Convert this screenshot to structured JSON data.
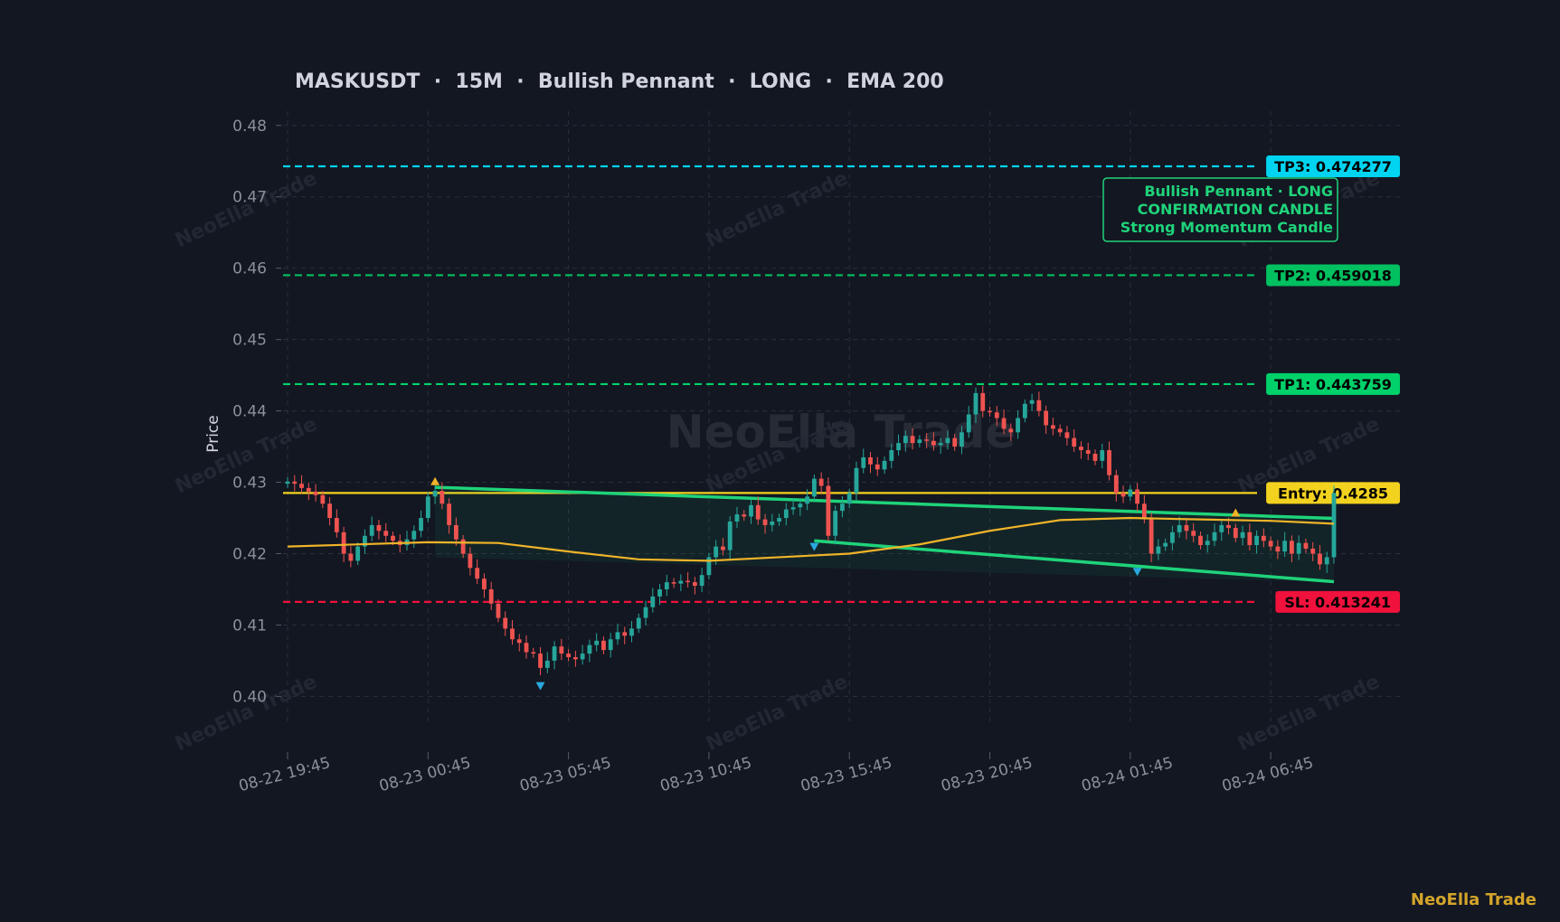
{
  "chart_data": {
    "type": "candlestick",
    "title": "MASKUSDT  ·  15M  ·  Bullish Pennant  ·  LONG  ·  EMA 200",
    "ylabel": "Price",
    "ylim": [
      0.396,
      0.482
    ],
    "yticks": [
      "0.40",
      "0.41",
      "0.42",
      "0.43",
      "0.44",
      "0.45",
      "0.46",
      "0.47",
      "0.48"
    ],
    "ytick_values": [
      0.4,
      0.41,
      0.42,
      0.43,
      0.44,
      0.45,
      0.46,
      0.47,
      0.48
    ],
    "xticks": [
      "08-22 19:45",
      "08-23 00:45",
      "08-23 05:45",
      "08-23 10:45",
      "08-23 15:45",
      "08-23 20:45",
      "08-24 01:45",
      "08-24 06:45"
    ],
    "xtick_index": [
      0,
      20,
      40,
      60,
      80,
      100,
      120,
      140
    ],
    "candle_count": 150,
    "grid": true,
    "levels": [
      {
        "label": "TP3: 0.474277",
        "value": 0.474277,
        "color": "#00d4f0",
        "dash": true
      },
      {
        "label": "TP2: 0.459018",
        "value": 0.459018,
        "color": "#00c060",
        "dash": true
      },
      {
        "label": "TP1: 0.443759",
        "value": 0.443759,
        "color": "#00d16a",
        "dash": true
      },
      {
        "label": "Entry: 0.4285",
        "value": 0.4285,
        "color": "#f3d21f",
        "dash": false
      },
      {
        "label": "SL: 0.413241",
        "value": 0.413241,
        "color": "#f0123c",
        "dash": true
      }
    ],
    "annotation": [
      "Bullish Pennant · LONG",
      "CONFIRMATION CANDLE",
      "Strong Momentum Candle"
    ],
    "watermark": "NeoElla Trade",
    "colors": {
      "up": "#26a69a",
      "down": "#ef5350",
      "ema": "#f0b429",
      "pattern": "#1fd37a",
      "bg": "#131722",
      "marker_high": "#f0b429",
      "marker_low": "#29a8e0"
    },
    "pennant": {
      "upper": {
        "x": [
          21,
          150
        ],
        "y": [
          0.4293,
          0.4249
        ]
      },
      "lower": {
        "x": [
          75,
          150
        ],
        "y": [
          0.4218,
          0.416
        ]
      }
    },
    "markers": [
      {
        "x": 21,
        "y": 0.4296,
        "type": "high"
      },
      {
        "x": 36,
        "y": 0.402,
        "type": "low"
      },
      {
        "x": 75,
        "y": 0.4215,
        "type": "low"
      },
      {
        "x": 121,
        "y": 0.418,
        "type": "low"
      },
      {
        "x": 135,
        "y": 0.4252,
        "type": "high"
      }
    ],
    "closes": [
      0.4301,
      0.4298,
      0.4292,
      0.4287,
      0.4282,
      0.427,
      0.425,
      0.423,
      0.42,
      0.419,
      0.421,
      0.4225,
      0.424,
      0.4232,
      0.4225,
      0.4218,
      0.4212,
      0.422,
      0.4232,
      0.425,
      0.428,
      0.4288,
      0.427,
      0.424,
      0.422,
      0.42,
      0.418,
      0.4165,
      0.415,
      0.413,
      0.411,
      0.4095,
      0.408,
      0.4075,
      0.4062,
      0.406,
      0.404,
      0.405,
      0.407,
      0.406,
      0.4055,
      0.4052,
      0.406,
      0.4072,
      0.4078,
      0.4065,
      0.408,
      0.409,
      0.4085,
      0.4095,
      0.411,
      0.4125,
      0.414,
      0.415,
      0.416,
      0.4158,
      0.4162,
      0.416,
      0.4155,
      0.417,
      0.4195,
      0.421,
      0.4205,
      0.4245,
      0.4255,
      0.4252,
      0.4268,
      0.4248,
      0.424,
      0.4245,
      0.425,
      0.4262,
      0.4265,
      0.427,
      0.428,
      0.4305,
      0.4295,
      0.4225,
      0.426,
      0.427,
      0.4285,
      0.432,
      0.4335,
      0.4325,
      0.4318,
      0.433,
      0.4345,
      0.4355,
      0.4365,
      0.4355,
      0.436,
      0.4358,
      0.4352,
      0.4355,
      0.4362,
      0.435,
      0.437,
      0.4395,
      0.4425,
      0.44,
      0.4398,
      0.439,
      0.4375,
      0.437,
      0.439,
      0.441,
      0.4415,
      0.44,
      0.438,
      0.4375,
      0.437,
      0.4362,
      0.435,
      0.4345,
      0.434,
      0.433,
      0.4345,
      0.431,
      0.4285,
      0.428,
      0.429,
      0.427,
      0.425,
      0.42,
      0.421,
      0.4215,
      0.423,
      0.424,
      0.4232,
      0.4225,
      0.4212,
      0.4218,
      0.423,
      0.424,
      0.4236,
      0.4222,
      0.423,
      0.4212,
      0.4225,
      0.4218,
      0.421,
      0.4203,
      0.4218,
      0.42,
      0.4215,
      0.4207,
      0.42,
      0.4185,
      0.4195,
      0.4285
    ],
    "ema": {
      "x": [
        0,
        20,
        30,
        40,
        50,
        60,
        70,
        80,
        90,
        100,
        110,
        120,
        130,
        140,
        150
      ],
      "y": [
        0.421,
        0.4216,
        0.4215,
        0.4203,
        0.4192,
        0.419,
        0.4195,
        0.42,
        0.4213,
        0.4232,
        0.4247,
        0.425,
        0.4248,
        0.4246,
        0.4242
      ]
    }
  },
  "brand": "NeoElla Trade"
}
